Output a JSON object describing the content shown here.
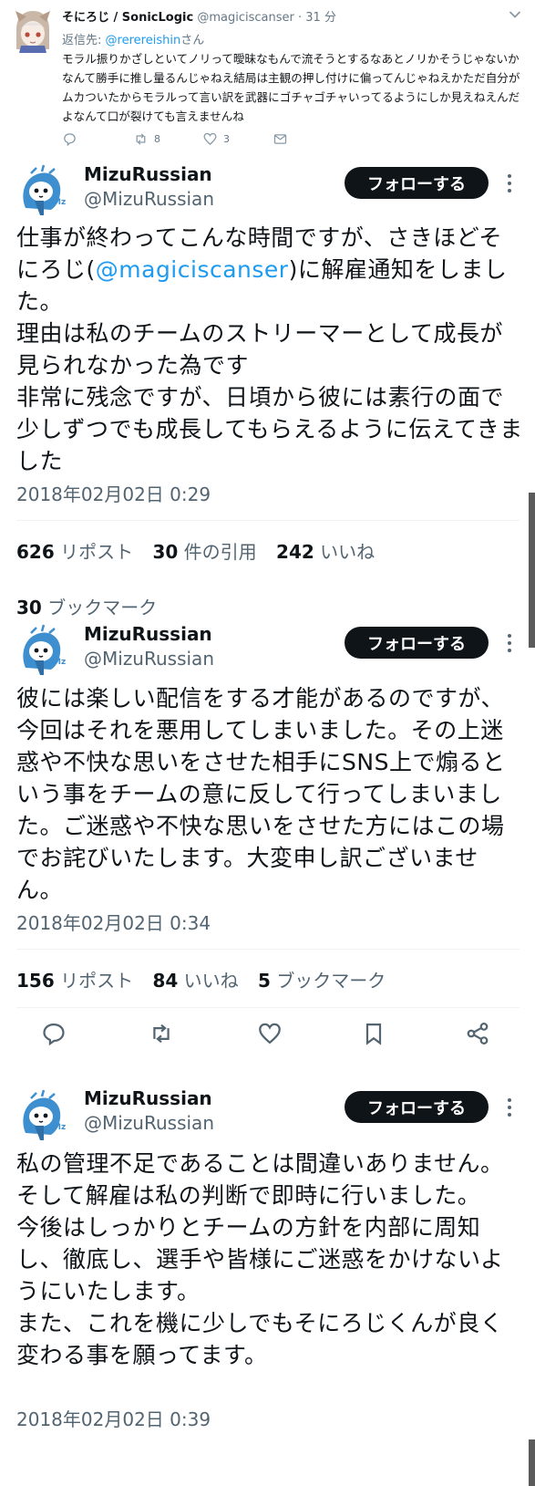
{
  "reply": {
    "author_name": "そにろじ / SonicLogic",
    "author_handle": "@magiciscanser",
    "separator": "·",
    "time": "31 分",
    "replying_to_label": "返信先:",
    "replying_to_handle": "@rerereishin",
    "replying_to_suffix": "さん",
    "text": "モラル振りかざしといてノリって曖昧なもんで流そうとするなあとノリかそうじゃないかなんて勝手に推し量るんじゃねえ結局は主観の押し付けに偏ってんじゃねえかただ自分がムカついたからモラルって言い訳を武器にゴチャゴチャいってるようにしか見えねえんだよなんて口が裂けても言えませんね",
    "retweet_count": "8",
    "like_count": "3"
  },
  "follow_label": "フォローする",
  "tweets": [
    {
      "author_name": "MizuRussian",
      "author_handle": "@MizuRussian",
      "text_before_link": "仕事が終わってこんな時間ですが、さきほどそにろじ(",
      "link": "@magiciscanser",
      "text_after_link": ")に解雇通知をしました。\n理由は私のチームのストリーマーとして成長が見られなかった為です\n非常に残念ですが、日頃から彼には素行の面で少しずつでも成長してもらえるように伝えてきました",
      "date": "2018年02月02日 0:29",
      "reposts_value": "626",
      "reposts_label": "リポスト",
      "quotes_value": "30",
      "quotes_label": "件の引用",
      "likes_value": "242",
      "likes_label": "いいね",
      "bookmarks_value": "30",
      "bookmarks_label": "ブックマーク"
    },
    {
      "author_name": "MizuRussian",
      "author_handle": "@MizuRussian",
      "text": "彼には楽しい配信をする才能があるのですが、今回はそれを悪用してしまいました。その上迷惑や不快な思いをさせた相手にSNS上で煽るという事をチームの意に反して行ってしまいました。ご迷惑や不快な思いをさせた方にはこの場でお詫びいたします。大変申し訳ございません。",
      "date": "2018年02月02日 0:34",
      "reposts_value": "156",
      "reposts_label": "リポスト",
      "likes_value": "84",
      "likes_label": "いいね",
      "bookmarks_value": "5",
      "bookmarks_label": "ブックマーク"
    },
    {
      "author_name": "MizuRussian",
      "author_handle": "@MizuRussian",
      "text": "私の管理不足であることは間違いありません。そして解雇は私の判断で即時に行いました。\n今後はしっかりとチームの方針を内部に周知し、徹底し、選手や皆様にご迷惑をかけないようにいたします。\nまた、これを機に少しでもそにろじくんが良く変わる事を願ってます。",
      "date": "2018年02月02日 0:39"
    }
  ],
  "icons": {
    "reply": "reply-icon",
    "retweet": "retweet-icon",
    "like": "heart-icon",
    "message": "envelope-icon",
    "bookmark": "bookmark-icon",
    "share": "share-icon",
    "more": "more-dots-icon"
  },
  "colors": {
    "text": "#0f1419",
    "secondary": "#536471",
    "link": "#1d9bf0",
    "follow_bg": "#0f1419",
    "divider": "#eff3f4",
    "avatar_blue": "#3d8fcf"
  }
}
